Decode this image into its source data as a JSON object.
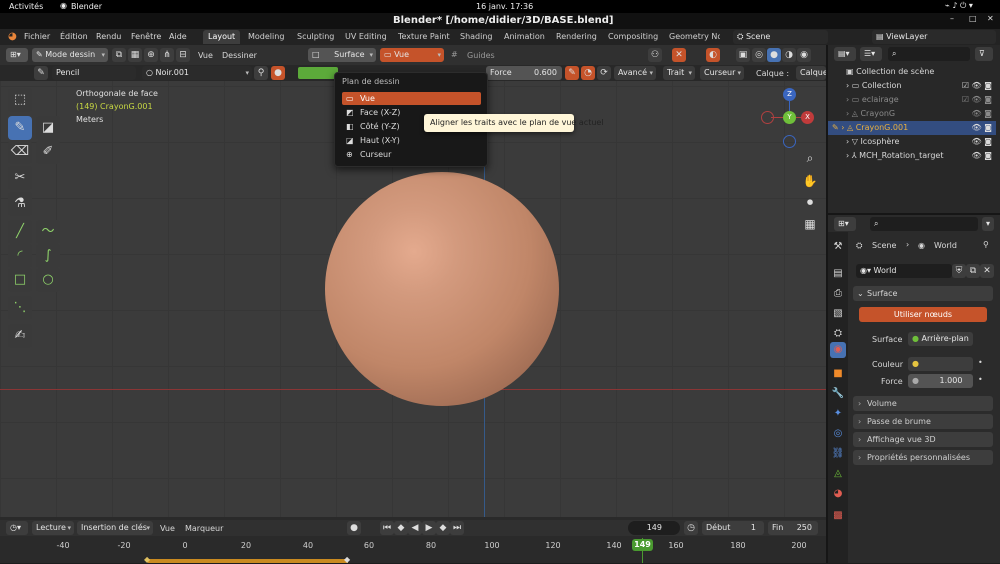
{
  "system_bar": {
    "activities": "Activités",
    "app_name": "Blender",
    "clock": "16 janv.  17:36"
  },
  "window_title": "Blender* [/home/didier/3D/BASE.blend]",
  "menu": {
    "items": [
      "Fichier",
      "Édition",
      "Rendu",
      "Fenêtre",
      "Aide"
    ]
  },
  "workspace_tabs": [
    "Layout",
    "Modeling",
    "Sculpting",
    "UV Editing",
    "Texture Paint",
    "Shading",
    "Animation",
    "Rendering",
    "Compositing",
    "Geometry No"
  ],
  "scene_field": "Scene",
  "viewlayer_field": "ViewLayer",
  "header": {
    "mode": "Mode dessin",
    "view": "Vue",
    "draw": "Dessiner",
    "surface": "Surface",
    "plane": "Vue",
    "guides": "Guides"
  },
  "tool_settings": {
    "brush": "Pencil",
    "material": "Noir.001",
    "strength_label": "Force",
    "strength_value": "0.600",
    "advanced": "Avancé",
    "stroke": "Trait",
    "cursor": "Curseur",
    "layer_label": "Calque :",
    "layer_value": "Calque"
  },
  "viewport": {
    "view_name": "Orthogonale de face",
    "object_info": "(149) CrayonG.001",
    "units": "Meters",
    "accent_color": "#c8d843"
  },
  "gizmo": {
    "z": "Z",
    "y": "Y",
    "x": "X"
  },
  "drawing_plane_menu": {
    "title": "Plan de dessin",
    "items": [
      "Vue",
      "Face (X-Z)",
      "Côté (Y-Z)",
      "Haut (X-Y)",
      "Curseur"
    ],
    "selected": "Vue",
    "tooltip": "Aligner les traits avec le plan de vue actuel"
  },
  "outliner": {
    "root": "Collection de scène",
    "items": [
      {
        "label": "Collection",
        "color": "#d0d0d0"
      },
      {
        "label": "eclairage",
        "color": "#8a8a8a"
      },
      {
        "label": "CrayonG",
        "color": "#8a8a8a"
      },
      {
        "label": "CrayonG.001",
        "color": "#e8b040"
      },
      {
        "label": "Icosphère",
        "color": "#d0d0d0"
      },
      {
        "label": "MCH_Rotation_target",
        "color": "#d0d0d0"
      }
    ]
  },
  "properties": {
    "breadcrumb_scene": "Scene",
    "breadcrumb_world": "World",
    "world_name": "World",
    "surface_section": "Surface",
    "use_nodes": "Utiliser nœuds",
    "surface_label": "Surface",
    "surface_value": "Arrière-plan",
    "color_label": "Couleur",
    "strength_label": "Force",
    "strength_value": "1.000",
    "sections": [
      "Volume",
      "Passe de brume",
      "Affichage vue 3D",
      "Propriétés personnalisées"
    ]
  },
  "timeline": {
    "playback": "Lecture",
    "keying": "Insertion de clés",
    "view": "Vue",
    "marker": "Marqueur",
    "current_frame": "149",
    "start_label": "Début",
    "start": "1",
    "end_label": "Fin",
    "end": "250",
    "ticks": [
      "-40",
      "-20",
      "0",
      "20",
      "40",
      "60",
      "80",
      "100",
      "120",
      "140",
      "160",
      "180",
      "200"
    ]
  },
  "colors": {
    "accent_orange": "#e0622f",
    "active_blue": "#4772b3",
    "sphere": "#c98d72"
  }
}
